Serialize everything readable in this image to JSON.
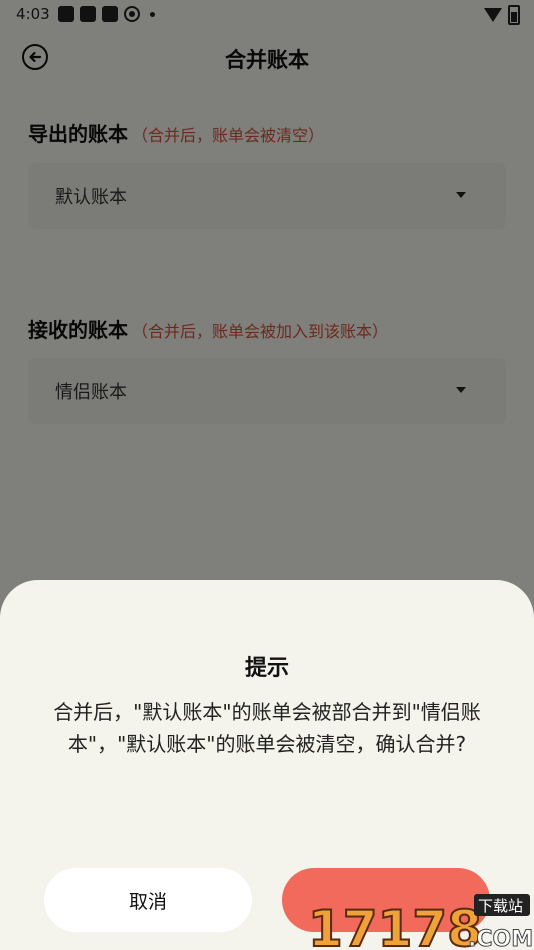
{
  "status_bar": {
    "time": "4:03"
  },
  "header": {
    "title": "合并账本",
    "back_icon": "back-arrow-circle-icon"
  },
  "export_section": {
    "label": "导出的账本",
    "note": "（合并后，账单会被清空）",
    "selected": "默认账本"
  },
  "receive_section": {
    "label": "接收的账本",
    "note": "（合并后，账单会被加入到该账本）",
    "selected": "情侣账本"
  },
  "dialog": {
    "title": "提示",
    "message": "合并后，\"默认账本\"的账单会被部合并到\"情侣账本\"，\"默认账本\"的账单会被清空，确认合并?",
    "cancel_label": "取消"
  },
  "watermark": {
    "text": "17178.COM",
    "badge": "下载站"
  },
  "colors": {
    "accent": "#f26a5c",
    "note": "#d0513a",
    "background": "#f4f4ee"
  }
}
